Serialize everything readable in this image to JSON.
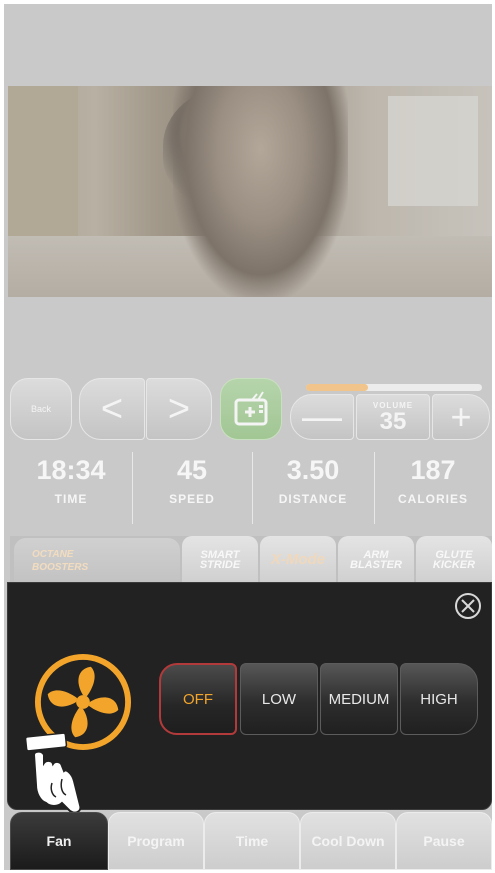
{
  "controls": {
    "back_label": "Back",
    "prev_symbol": "<",
    "next_symbol": ">",
    "volume_label": "VOLUME",
    "volume_value": "35",
    "volume_level": 0.35,
    "minus_symbol": "—",
    "plus_symbol": "+"
  },
  "stats": [
    {
      "value": "18:34",
      "label": "TIME"
    },
    {
      "value": "45",
      "label": "SPEED"
    },
    {
      "value": "3.50",
      "label": "DISTANCE"
    },
    {
      "value": "187",
      "label": "CALORIES"
    }
  ],
  "boosters": {
    "title_line1": "OCTANE",
    "title_line2": "BOOSTERS",
    "items": [
      "SMART STRIDE",
      "X-Mode",
      "ARM BLASTER",
      "GLUTE KICKER"
    ]
  },
  "fan": {
    "options": [
      "OFF",
      "LOW",
      "MEDIUM",
      "HIGH"
    ],
    "selected": "OFF",
    "accent_color": "#f3a52b"
  },
  "tabs": [
    "Fan",
    "Program",
    "Time",
    "Cool Down",
    "Pause"
  ],
  "active_tab": "Fan"
}
